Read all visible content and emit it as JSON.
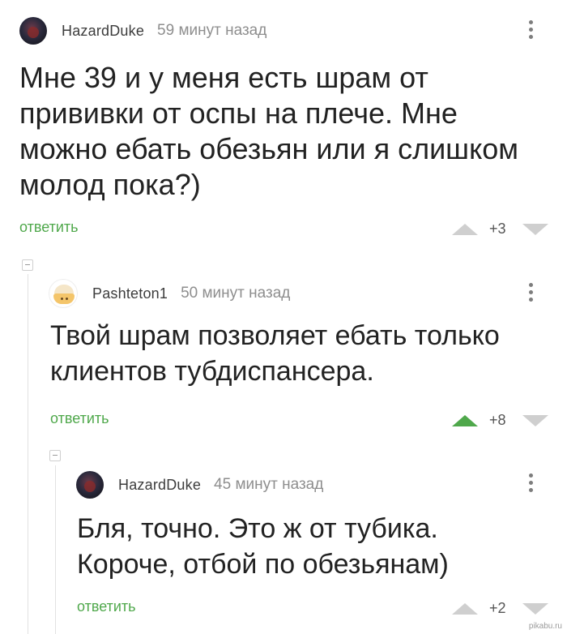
{
  "comments": [
    {
      "username": "HazardDuke",
      "time": "59 минут назад",
      "text": "Мне 39 и у меня есть шрам от прививки от оспы на плече. Мне можно ебать обезьян или я слишком молод пока?)",
      "reply_label": "ответить",
      "rating": "+3",
      "avatar": "dark-avatar-icon",
      "upvoted": false
    },
    {
      "username": "Pashteton1",
      "time": "50 минут назад",
      "text": "Твой шрам позволяет ебать только клиентов тубдиспансера.",
      "reply_label": "ответить",
      "rating": "+8",
      "avatar": "egg-avatar-icon",
      "upvoted": true
    },
    {
      "username": "HazardDuke",
      "time": "45 минут назад",
      "text": "Бля, точно. Это ж от тубика. Короче, отбой по обезьянам)",
      "reply_label": "ответить",
      "rating": "+2",
      "avatar": "dark-avatar-icon",
      "upvoted": false
    }
  ],
  "watermark": "pikabu.ru",
  "colors": {
    "accent_green": "#4fa84b",
    "vote_gray": "#cfcfcf",
    "meta_gray": "#8e8e8e"
  }
}
